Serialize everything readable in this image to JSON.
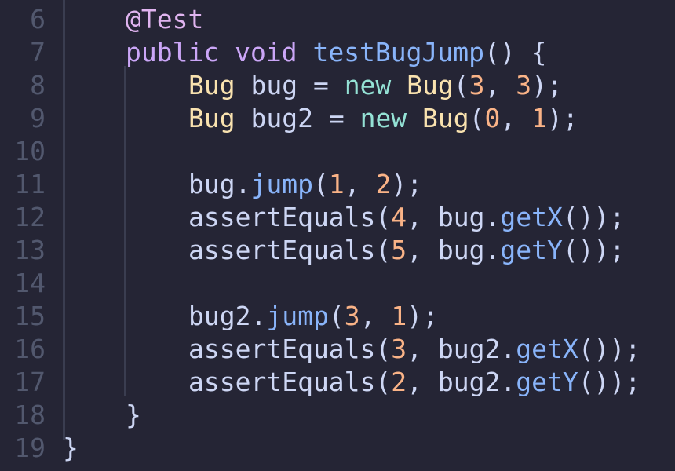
{
  "editor": {
    "language": "java",
    "colors": {
      "background": "#252535",
      "line_number": "#52586e",
      "annotation": "#e0b4f0",
      "keyword": "#cba6f7",
      "function": "#89b4fa",
      "type": "#f9e2af",
      "new_keyword": "#94e2d5",
      "number": "#fab387",
      "identifier": "#cdd6f4",
      "indent_guide": "#3a3d50"
    },
    "line_numbers": [
      "6",
      "7",
      "8",
      "9",
      "10",
      "11",
      "12",
      "13",
      "14",
      "15",
      "16",
      "17",
      "18",
      "19"
    ],
    "lines": [
      {
        "tokens": [
          {
            "t": "@Test",
            "c": "anno"
          }
        ]
      },
      {
        "tokens": [
          {
            "t": "public",
            "c": "kw"
          },
          {
            "t": " ",
            "c": "punc"
          },
          {
            "t": "void",
            "c": "kw"
          },
          {
            "t": " ",
            "c": "punc"
          },
          {
            "t": "testBugJump",
            "c": "fn"
          },
          {
            "t": "() {",
            "c": "punc"
          }
        ]
      },
      {
        "tokens": [
          {
            "t": "Bug",
            "c": "type"
          },
          {
            "t": " bug = ",
            "c": "id"
          },
          {
            "t": "new",
            "c": "new"
          },
          {
            "t": " ",
            "c": "punc"
          },
          {
            "t": "Bug",
            "c": "type"
          },
          {
            "t": "(",
            "c": "punc"
          },
          {
            "t": "3",
            "c": "num"
          },
          {
            "t": ", ",
            "c": "punc"
          },
          {
            "t": "3",
            "c": "num"
          },
          {
            "t": ");",
            "c": "punc"
          }
        ]
      },
      {
        "tokens": [
          {
            "t": "Bug",
            "c": "type"
          },
          {
            "t": " bug2 = ",
            "c": "id"
          },
          {
            "t": "new",
            "c": "new"
          },
          {
            "t": " ",
            "c": "punc"
          },
          {
            "t": "Bug",
            "c": "type"
          },
          {
            "t": "(",
            "c": "punc"
          },
          {
            "t": "0",
            "c": "num"
          },
          {
            "t": ", ",
            "c": "punc"
          },
          {
            "t": "1",
            "c": "num"
          },
          {
            "t": ");",
            "c": "punc"
          }
        ]
      },
      {
        "tokens": []
      },
      {
        "tokens": [
          {
            "t": "bug.",
            "c": "id"
          },
          {
            "t": "jump",
            "c": "meth"
          },
          {
            "t": "(",
            "c": "punc"
          },
          {
            "t": "1",
            "c": "num"
          },
          {
            "t": ", ",
            "c": "punc"
          },
          {
            "t": "2",
            "c": "num"
          },
          {
            "t": ");",
            "c": "punc"
          }
        ]
      },
      {
        "tokens": [
          {
            "t": "assertEquals(",
            "c": "id"
          },
          {
            "t": "4",
            "c": "num"
          },
          {
            "t": ", bug.",
            "c": "id"
          },
          {
            "t": "getX",
            "c": "meth"
          },
          {
            "t": "());",
            "c": "punc"
          }
        ]
      },
      {
        "tokens": [
          {
            "t": "assertEquals(",
            "c": "id"
          },
          {
            "t": "5",
            "c": "num"
          },
          {
            "t": ", bug.",
            "c": "id"
          },
          {
            "t": "getY",
            "c": "meth"
          },
          {
            "t": "());",
            "c": "punc"
          }
        ]
      },
      {
        "tokens": []
      },
      {
        "tokens": [
          {
            "t": "bug2.",
            "c": "id"
          },
          {
            "t": "jump",
            "c": "meth"
          },
          {
            "t": "(",
            "c": "punc"
          },
          {
            "t": "3",
            "c": "num"
          },
          {
            "t": ", ",
            "c": "punc"
          },
          {
            "t": "1",
            "c": "num"
          },
          {
            "t": ");",
            "c": "punc"
          }
        ]
      },
      {
        "tokens": [
          {
            "t": "assertEquals(",
            "c": "id"
          },
          {
            "t": "3",
            "c": "num"
          },
          {
            "t": ", bug2.",
            "c": "id"
          },
          {
            "t": "getX",
            "c": "meth"
          },
          {
            "t": "());",
            "c": "punc"
          }
        ]
      },
      {
        "tokens": [
          {
            "t": "assertEquals(",
            "c": "id"
          },
          {
            "t": "2",
            "c": "num"
          },
          {
            "t": ", bug2.",
            "c": "id"
          },
          {
            "t": "getY",
            "c": "meth"
          },
          {
            "t": "());",
            "c": "punc"
          }
        ]
      },
      {
        "tokens": [
          {
            "t": "}",
            "c": "punc"
          }
        ]
      },
      {
        "tokens": [
          {
            "t": "}",
            "c": "punc"
          }
        ]
      }
    ]
  }
}
